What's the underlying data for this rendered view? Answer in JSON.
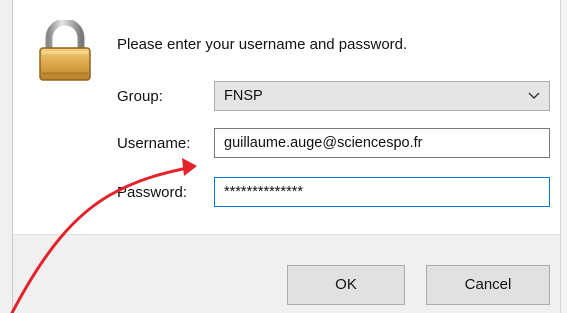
{
  "dialog": {
    "prompt": "Please enter your username and password."
  },
  "form": {
    "group_label": "Group:",
    "group_value": "FNSP",
    "username_label": "Username:",
    "username_value": "guillaume.auge@sciencespo.fr",
    "password_label": "Password:",
    "password_value": "**************"
  },
  "buttons": {
    "ok_label": "OK",
    "cancel_label": "Cancel"
  },
  "icons": {
    "lock": "padlock-icon",
    "dropdown": "chevron-down-icon"
  },
  "colors": {
    "focus_border": "#0078d7",
    "annotation_arrow": "#e3222b",
    "lock_body": "#d9a84a"
  }
}
